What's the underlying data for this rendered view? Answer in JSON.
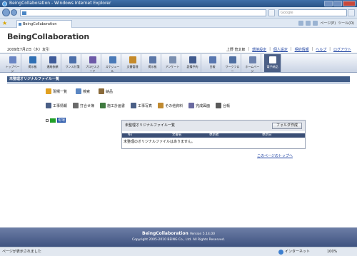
{
  "browser": {
    "window_title": "BeingCollaboration - Windows Internet Explorer",
    "search_placeholder": "Google",
    "tab_title": "BeingCollaboration",
    "tools": [
      "ページ(P)",
      "ツール(O)"
    ],
    "status_text": "ページが表示されました",
    "zone": "インターネット",
    "zoom": "100%"
  },
  "header": {
    "logo": "BeingCollaboration",
    "date": "2009年7月2日（木）友引",
    "user_name": "上野 管太郎",
    "links": [
      "環境設定",
      "個人設定",
      "契約情報",
      "ヘルプ",
      "ログアウト"
    ]
  },
  "toolbar": {
    "items": [
      {
        "label": "トップページ",
        "color": "#6a86c4"
      },
      {
        "label": "掲示板",
        "color": "#2f6fb4"
      },
      {
        "label": "連絡依頼",
        "color": "#3e5b9a"
      },
      {
        "label": "ワンス付箋",
        "color": "#4c6faa"
      },
      {
        "label": "プロセスカード",
        "color": "#6d5aa8"
      },
      {
        "label": "スケジュール",
        "color": "#4a7ab8"
      },
      {
        "label": "文書管理",
        "color": "#c58a2a"
      },
      {
        "label": "掲示板",
        "color": "#5b77a8"
      },
      {
        "label": "アンケート",
        "color": "#7a8fb0"
      },
      {
        "label": "設備予約",
        "color": "#405a8e"
      },
      {
        "label": "日報",
        "color": "#5877b0"
      },
      {
        "label": "ワークフロー",
        "color": "#4f6fa2"
      },
      {
        "label": "ホームページ",
        "color": "#6c82ae"
      },
      {
        "label": "電子納品",
        "color": "#ffffff"
      }
    ]
  },
  "main": {
    "section_title": "未整理オリジナルファイル一覧",
    "menu1": [
      {
        "label": "現場一覧",
        "color": "#e1a020"
      },
      {
        "label": "検索",
        "color": "#5a86c2"
      },
      {
        "label": "納品",
        "color": "#8a6a3a"
      }
    ],
    "menu2": [
      {
        "label": "工事情報",
        "color": "#4a5f86"
      },
      {
        "label": "打合せ簿",
        "color": "#6b6b6b"
      },
      {
        "label": "施工計画書",
        "color": "#3f7a3f"
      },
      {
        "label": "工事写真",
        "color": "#4a5f86"
      },
      {
        "label": "その他資料",
        "color": "#c08a30"
      },
      {
        "label": "完成図面",
        "color": "#6a6aa0"
      },
      {
        "label": "台帳",
        "color": "#5a5a5a"
      }
    ],
    "tree_expander": "-",
    "tree_label": "現場",
    "panel_title": "未整理オリジナルファイル一覧",
    "folder_button": "フォルダ作成",
    "columns": [
      "No",
      "文書名",
      "更新者",
      "更新日"
    ],
    "empty_message": "未整理のオリジナルファイルはありません。",
    "page_top_link": "このページのトップへ"
  },
  "footer": {
    "brand": "BeingCollaboration",
    "version": "Version 5.14.00",
    "copyright": "Copyright 2005-2010 BEING Co., Ltd. All Rights Reserved."
  }
}
